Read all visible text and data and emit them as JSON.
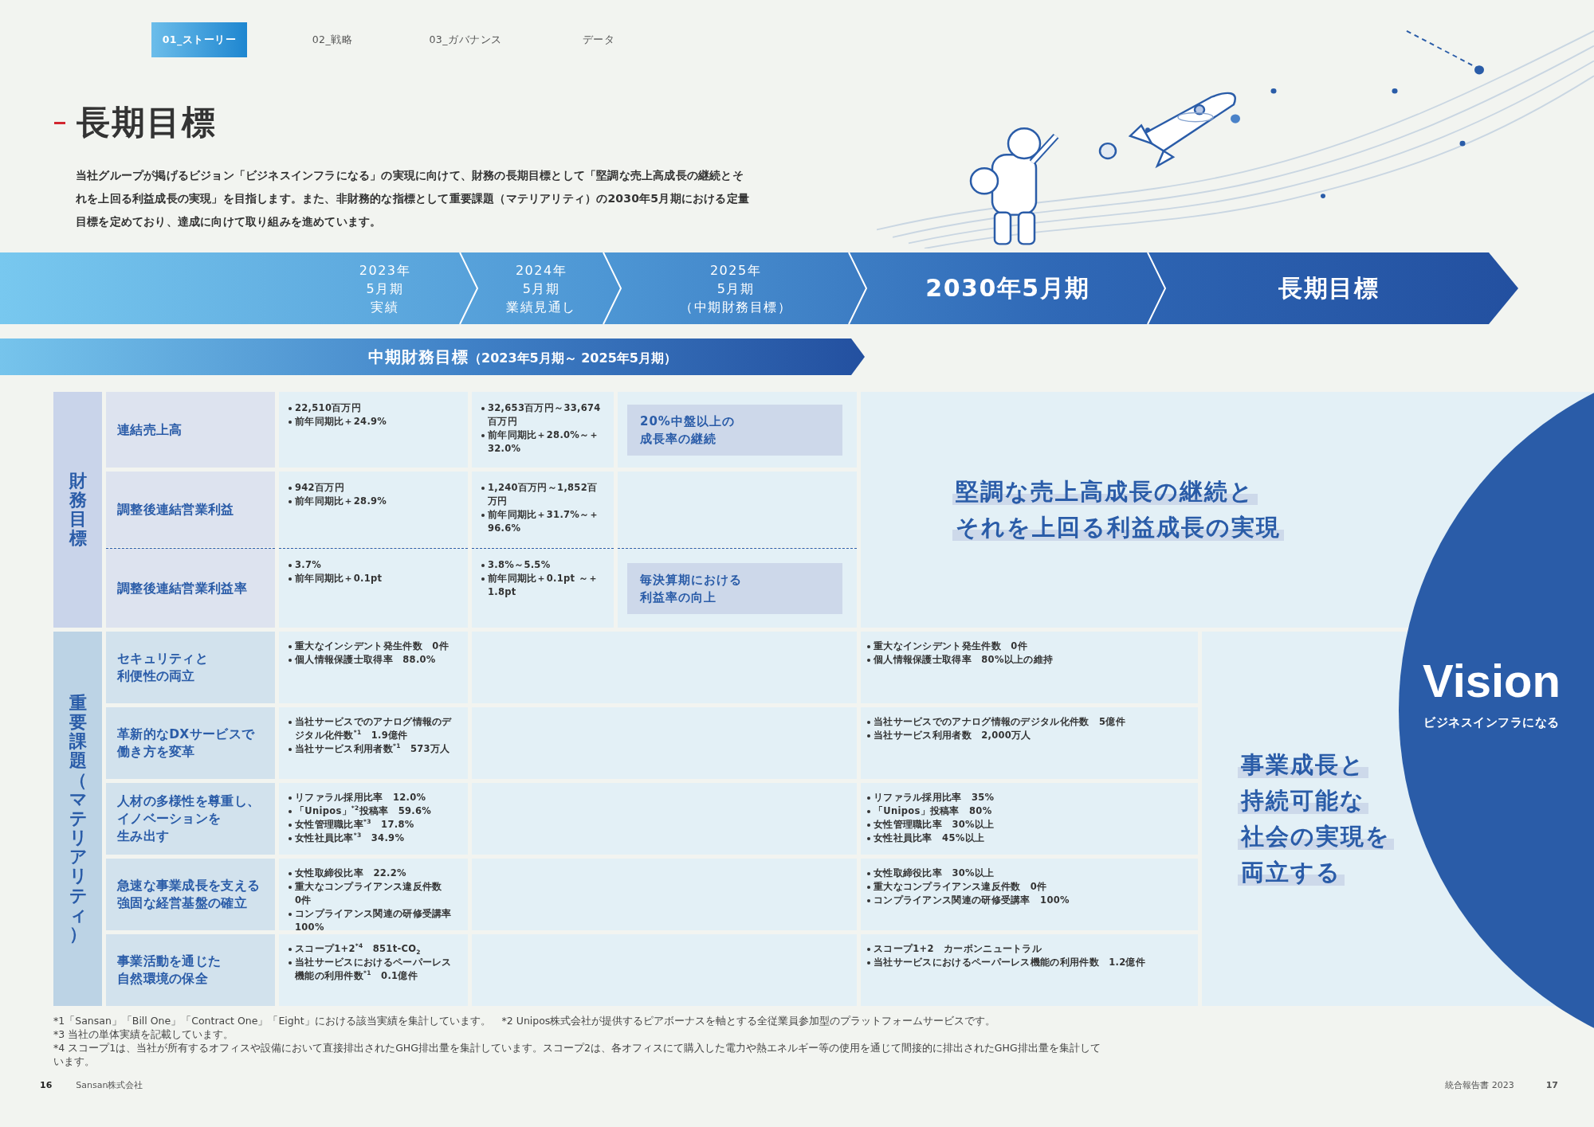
{
  "tabs": [
    {
      "label": "01_ストーリー",
      "selected": true
    },
    {
      "label": "02_戦略",
      "selected": false
    },
    {
      "label": "03_ガバナンス",
      "selected": false
    },
    {
      "label": "データ",
      "selected": false
    }
  ],
  "heading": "長期目標",
  "intro": "当社グループが掲げるビジョン「ビジネスインフラになる」の実現に向けて、財務の長期目標として「堅調な売上高成長の継続とそれを上回る利益成長の実現」を目指します。また、非財務的な指標として重要課題（マテリアリティ）の2030年5月期における定量目標を定めており、達成に向けて取り組みを進めています。",
  "timeline": [
    {
      "kind": "small",
      "lines": [
        "2023年",
        "5月期",
        "実績"
      ]
    },
    {
      "kind": "small",
      "lines": [
        "2024年",
        "5月期",
        "業績見通し"
      ]
    },
    {
      "kind": "small",
      "lines": [
        "2025年",
        "5月期",
        "（中期財務目標）"
      ]
    },
    {
      "kind": "large",
      "lines": [
        "2030年5月期"
      ]
    },
    {
      "kind": "large",
      "lines": [
        "長期目標"
      ]
    }
  ],
  "mid_term_band": {
    "title": "中期財務目標",
    "range": "（2023年5月期～ 2025年5月期）"
  },
  "financial": {
    "section": "財務目標",
    "rows": [
      {
        "label": "連結売上高",
        "joined": false,
        "fy2023": [
          "22,510百万円",
          "前年同期比＋24.9%"
        ],
        "fy2024": [
          "32,653百万円～33,674百万円",
          "前年同期比＋28.0%～＋32.0%"
        ],
        "target_2025": [
          "20%中盤以上の",
          "成長率の継続"
        ]
      },
      {
        "label": "調整後連結営業利益",
        "joined": false,
        "fy2023": [
          "942百万円",
          "前年同期比＋28.9%"
        ],
        "fy2024": [
          "1,240百万円～1,852百万円",
          "前年同期比＋31.7%～＋96.6%"
        ]
      },
      {
        "label": "調整後連結営業利益率",
        "joined": true,
        "fy2023": [
          "3.7%",
          "前年同期比＋0.1pt"
        ],
        "fy2024": [
          "3.8%～5.5%",
          "前年同期比＋0.1pt ～＋1.8pt"
        ],
        "target_2025": [
          "毎決算期における",
          "利益率の向上"
        ]
      }
    ],
    "long_term": [
      "堅調な売上高成長の継続と",
      "それを上回る利益成長の実現"
    ]
  },
  "materiality": {
    "section": "重要課題（マテリアリティ）",
    "rows": [
      {
        "label": [
          "セキュリティと",
          "利便性の両立"
        ],
        "fy2023": [
          "重大なインシデント発生件数　0件",
          "個人情報保護士取得率　88.0%"
        ],
        "target_2030": [
          "重大なインシデント発生件数　0件",
          "個人情報保護士取得率　80%以上の維持"
        ]
      },
      {
        "label": [
          "革新的なDXサービスで",
          "働き方を変革"
        ],
        "fy2023": [
          "当社サービスでのアナログ情報のデジタル化件数$^{*1}$　1.9億件",
          "当社サービス利用者数$^{*1}$　573万人"
        ],
        "target_2030": [
          "当社サービスでのアナログ情報のデジタル化件数　5億件",
          "当社サービス利用者数　2,000万人"
        ]
      },
      {
        "label": [
          "人材の多様性を尊重し、",
          "イノベーションを",
          "生み出す"
        ],
        "fy2023": [
          "リファラル採用比率　12.0%",
          "「Unipos」$^{*2}$投稿率　59.6%",
          "女性管理職比率$^{*3}$　17.8%",
          "女性社員比率$^{*3}$　34.9%"
        ],
        "target_2030": [
          "リファラル採用比率　35%",
          "「Unipos」投稿率　80%",
          "女性管理職比率　30%以上",
          "女性社員比率　45%以上"
        ]
      },
      {
        "label": [
          "急速な事業成長を支える",
          "強固な経営基盤の確立"
        ],
        "fy2023": [
          "女性取締役比率　22.2%",
          "重大なコンプライアンス違反件数　0件",
          "コンプライアンス関連の研修受講率　100%"
        ],
        "target_2030": [
          "女性取締役比率　30%以上",
          "重大なコンプライアンス違反件数　0件",
          "コンプライアンス関連の研修受講率　100%"
        ]
      },
      {
        "label": [
          "事業活動を通じた",
          "自然環境の保全"
        ],
        "fy2023": [
          "スコープ1+2$^{*4}$　851t-CO$_{2}$",
          "当社サービスにおけるペーパーレス機能の利用件数$^{*1}$　0.1億件"
        ],
        "target_2030": [
          "スコープ1+2　カーボンニュートラル",
          "当社サービスにおけるペーパーレス機能の利用件数　1.2億件"
        ]
      }
    ],
    "statement": [
      "事業成長と",
      "持続可能な",
      "社会の実現を",
      "両立する"
    ]
  },
  "vision": {
    "title": "Vision",
    "subtitle": "ビジネスインフラになる"
  },
  "footnotes": [
    [
      "*1「Sansan」「Bill One」「Contract One」「Eight」における該当実績を集計しています。",
      "*2 Unipos株式会社が提供するピアボーナスを軸とする全従業員参加型のプラットフォームサービスです。"
    ],
    [
      "*3 当社の単体実績を記載しています。",
      "*4 スコープ1は、当社が所有するオフィスや設備において直接排出されたGHG排出量を集計しています。スコープ2は、各オフィスにて購入した電力や熱エネルギー等の使用を通じて間接的に排出されたGHG排出量を集計しています。"
    ]
  ],
  "footer": {
    "left_page": "16",
    "company": "Sansan株式会社",
    "report": "統合報告書 2023",
    "right_page": "17"
  }
}
